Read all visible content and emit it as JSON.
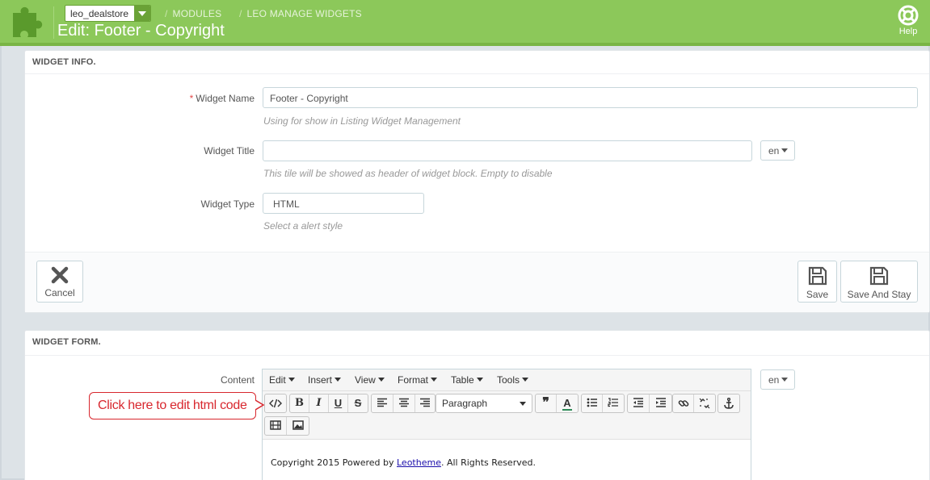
{
  "header": {
    "shop_name": "leo_dealstore",
    "breadcrumb": [
      "MODULES",
      "LEO MANAGE WIDGETS"
    ],
    "title": "Edit: Footer - Copyright",
    "help_label": "Help",
    "color": "#8cc85a"
  },
  "widget_info": {
    "heading": "WIDGET INFO.",
    "name_label": "Widget Name",
    "name_value": "Footer - Copyright",
    "name_hint": "Using for show in Listing Widget Management",
    "title_label": "Widget Title",
    "title_value": "",
    "title_lang": "en",
    "title_hint": "This tile will be showed as header of widget block. Empty to disable",
    "type_label": "Widget Type",
    "type_value": "HTML",
    "type_hint": "Select a alert style",
    "cancel_label": "Cancel",
    "save_label": "Save",
    "save_stay_label": "Save And Stay"
  },
  "widget_form": {
    "heading": "WIDGET FORM.",
    "content_label": "Content",
    "content_lang": "en",
    "menu": [
      "Edit",
      "Insert",
      "View",
      "Format",
      "Table",
      "Tools"
    ],
    "format_select": "Paragraph",
    "content_prefix": "Copyright 2015 Powered by ",
    "content_link": "Leotheme",
    "content_suffix": ". All Rights Reserved."
  },
  "callout": {
    "text": "Click here to edit html code",
    "color": "#d8272e"
  }
}
